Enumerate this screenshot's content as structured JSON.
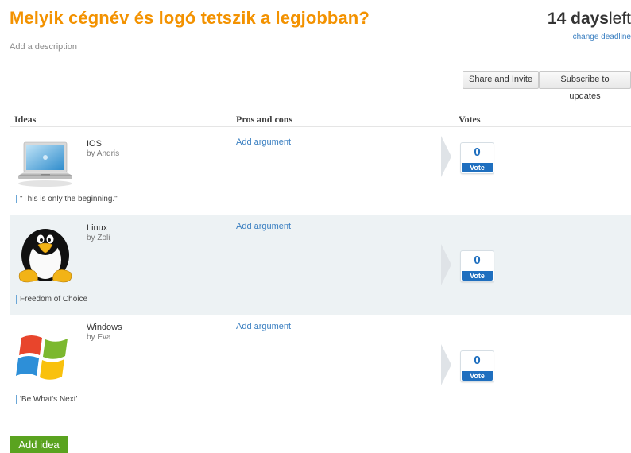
{
  "header": {
    "title": "Melyik cégnév és logó tetszik a legjobban?",
    "description_placeholder": "Add a description",
    "days_count": "14 days",
    "days_suffix": "left",
    "change_deadline": "change deadline"
  },
  "toolbar": {
    "share_label": "Share and Invite",
    "subscribe_label": "Subscribe to updates"
  },
  "table": {
    "headers": [
      "Ideas",
      "Pros and cons",
      "Votes"
    ]
  },
  "ideas": [
    {
      "name": "IOS",
      "by": "by Andris",
      "add_argument": "Add argument",
      "quote": "\"This is only the beginning.\"",
      "votes": "0",
      "vote_label": "Vote",
      "icon": "laptop-icon"
    },
    {
      "name": "Linux",
      "by": "by Zoli",
      "add_argument": "Add argument",
      "quote": "Freedom of Choice",
      "votes": "0",
      "vote_label": "Vote",
      "icon": "tux-penguin-icon"
    },
    {
      "name": "Windows",
      "by": "by Eva",
      "add_argument": "Add argument",
      "quote": "'Be What's Next'",
      "votes": "0",
      "vote_label": "Vote",
      "icon": "windows-logo-icon"
    }
  ],
  "footer": {
    "add_idea_label": "Add idea"
  },
  "colors": {
    "title": "#f39200",
    "link": "#3a7fc1",
    "vote_blue": "#1f6fbf",
    "row_alt": "#edf2f4",
    "add_idea_green": "#5aa31f"
  }
}
